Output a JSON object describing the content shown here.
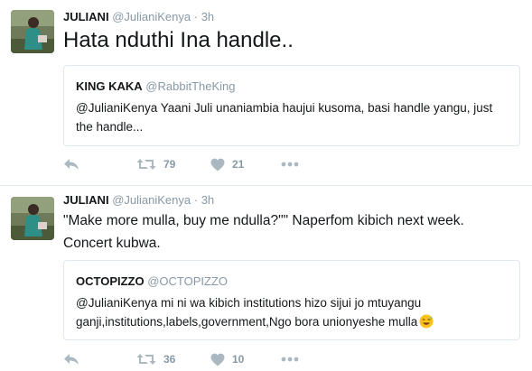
{
  "tweets": [
    {
      "author": {
        "name": "JULIANI",
        "handle": "@JulianiKenya",
        "time": "3h"
      },
      "text": "Hata nduthi Ina handle..",
      "quote": {
        "author": {
          "name": "KING KAKA",
          "handle": "@RabbitTheKing"
        },
        "text": "@JulianiKenya Yaani Juli unaniambia haujui kusoma,  basi handle yangu, just the handle..."
      },
      "actions": {
        "retweets": "79",
        "likes": "21"
      }
    },
    {
      "author": {
        "name": "JULIANI",
        "handle": "@JulianiKenya",
        "time": "3h"
      },
      "text": "\"Make more mulla, buy me ndulla?\"\" Naperfom kibich next week. Concert kubwa.",
      "quote": {
        "author": {
          "name": "OCTOPIZZO",
          "handle": "@OCTOPIZZO"
        },
        "text": "@JulianiKenya mi  ni wa kibich institutions hizo  sijui jo mtuyangu ganji,institutions,labels,government,Ngo  bora unionyeshe mulla"
      },
      "actions": {
        "retweets": "36",
        "likes": "10"
      }
    }
  ],
  "separator": "·",
  "icons": {
    "reply": "reply-icon",
    "retweet": "retweet-icon",
    "like": "heart-icon",
    "more": "more-icon",
    "emoji": "sweat-smile-emoji-icon"
  },
  "colors": {
    "text": "#14171a",
    "muted": "#8899a6",
    "border": "#e1e8ed",
    "icon": "#aab8c2"
  }
}
